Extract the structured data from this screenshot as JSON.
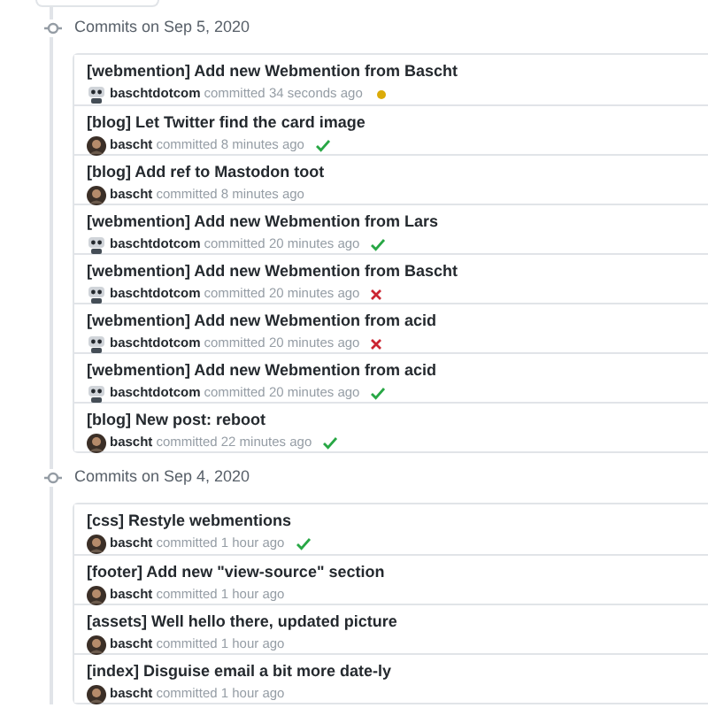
{
  "groups": [
    {
      "heading": "Commits on Sep 5, 2020",
      "commits": [
        {
          "title": "[webmention] Add new Webmention from Bascht",
          "author": "baschtdotcom",
          "kind": "bot",
          "meta": "committed 34 seconds ago",
          "status": {
            "kind": "pending"
          }
        },
        {
          "title": "[blog] Let Twitter find the card image",
          "author": "bascht",
          "kind": "person",
          "meta": "committed 8 minutes ago",
          "status": {
            "kind": "success"
          }
        },
        {
          "title": "[blog] Add ref to Mastodon toot",
          "author": "bascht",
          "kind": "person",
          "meta": "committed 8 minutes ago"
        },
        {
          "title": "[webmention] Add new Webmention from Lars",
          "author": "baschtdotcom",
          "kind": "bot",
          "meta": "committed 20 minutes ago",
          "status": {
            "kind": "success"
          }
        },
        {
          "title": "[webmention] Add new Webmention from Bascht",
          "author": "baschtdotcom",
          "kind": "bot",
          "meta": "committed 20 minutes ago",
          "status": {
            "kind": "failure"
          }
        },
        {
          "title": "[webmention] Add new Webmention from acid",
          "author": "baschtdotcom",
          "kind": "bot",
          "meta": "committed 20 minutes ago",
          "status": {
            "kind": "failure"
          }
        },
        {
          "title": "[webmention] Add new Webmention from acid",
          "author": "baschtdotcom",
          "kind": "bot",
          "meta": "committed 20 minutes ago",
          "status": {
            "kind": "success"
          }
        },
        {
          "title": "[blog] New post: reboot",
          "author": "bascht",
          "kind": "person",
          "meta": "committed 22 minutes ago",
          "status": {
            "kind": "success"
          }
        }
      ]
    },
    {
      "heading": "Commits on Sep 4, 2020",
      "commits": [
        {
          "title": "[css] Restyle webmentions",
          "author": "bascht",
          "kind": "person",
          "meta": "committed 1 hour ago",
          "status": {
            "kind": "success"
          }
        },
        {
          "title": "[footer] Add new \"view-source\" section",
          "author": "bascht",
          "kind": "person",
          "meta": "committed 1 hour ago"
        },
        {
          "title": "[assets] Well hello there, updated picture",
          "author": "bascht",
          "kind": "person",
          "meta": "committed 1 hour ago"
        },
        {
          "title": "[index] Disguise email a bit more date-ly",
          "author": "bascht",
          "kind": "person",
          "meta": "committed 1 hour ago"
        }
      ]
    }
  ]
}
